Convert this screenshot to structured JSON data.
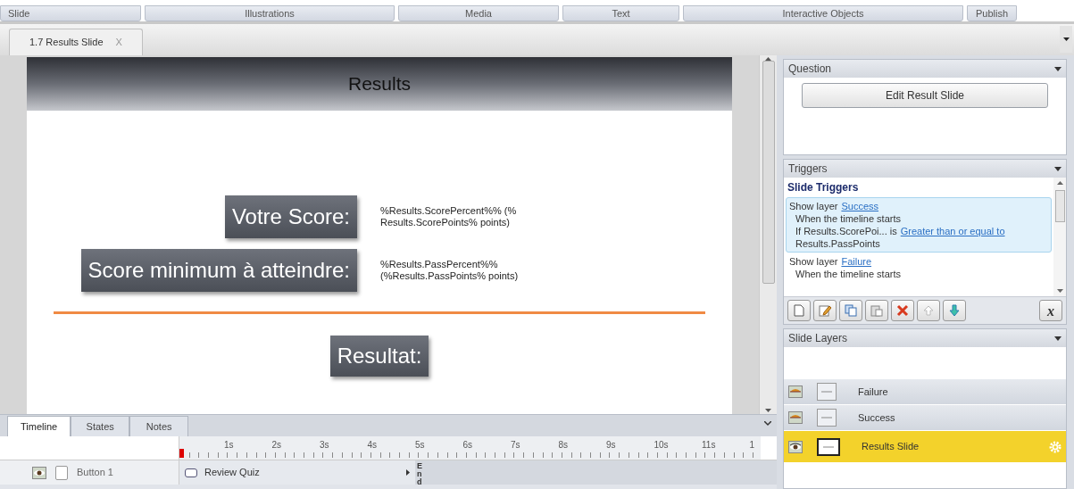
{
  "ribbon_groups": [
    "Slide",
    "Illustrations",
    "Media",
    "Text",
    "Interactive Objects",
    "Publish"
  ],
  "document_tab": {
    "label": "1.7 Results Slide",
    "close": "X"
  },
  "slide": {
    "title": "Results",
    "rows": [
      {
        "label": "Votre Score:",
        "value": "%Results.ScorePercent%% (% Results.ScorePoints% points)"
      },
      {
        "label": "Score minimum à atteindre:",
        "value": "%Results.PassPercent%% (%Results.PassPoints% points)"
      }
    ],
    "result_label": "Resultat:"
  },
  "question_panel": {
    "title": "Question",
    "button": "Edit Result Slide"
  },
  "triggers_panel": {
    "title": "Triggers",
    "section": "Slide Triggers",
    "triggers": [
      {
        "action": "Show layer",
        "target": "Success",
        "when": "When the timeline starts",
        "condition": "If Results.ScorePoi... is",
        "operator": "Greater than or equal to",
        "value": "Results.PassPoints",
        "selected": true
      },
      {
        "action": "Show layer",
        "target": "Failure",
        "when": "When the timeline starts",
        "selected": false
      }
    ],
    "variables_button": "x"
  },
  "layers_panel": {
    "title": "Slide Layers",
    "layers": [
      {
        "name": "Failure",
        "selected": false
      },
      {
        "name": "Success",
        "selected": false
      },
      {
        "name": "Results Slide",
        "selected": true
      }
    ]
  },
  "timeline": {
    "tabs": [
      {
        "label": "Timeline",
        "selected": true
      },
      {
        "label": "States",
        "selected": false
      },
      {
        "label": "Notes",
        "selected": false
      }
    ],
    "ticks": [
      "1s",
      "2s",
      "3s",
      "4s",
      "5s",
      "6s",
      "7s",
      "8s",
      "9s",
      "10s",
      "11s",
      "1"
    ],
    "rows": [
      {
        "name": "Button 1",
        "locked": false,
        "object": "Review Quiz",
        "end": "End"
      }
    ]
  }
}
